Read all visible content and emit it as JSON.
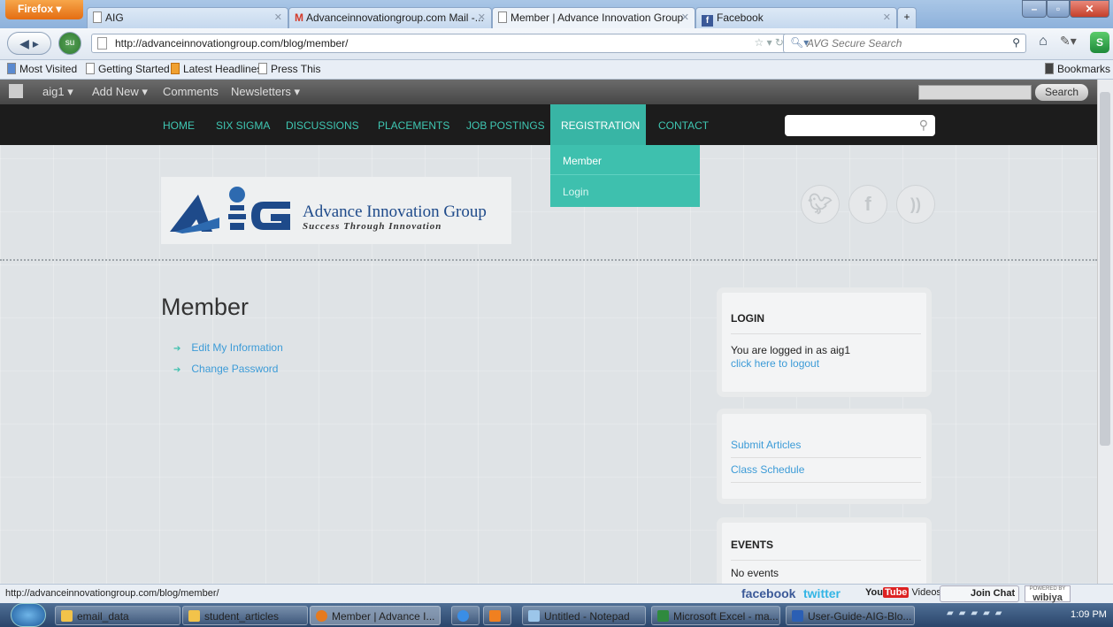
{
  "browser": {
    "menu_label": "Firefox",
    "tabs": [
      {
        "label": "AIG"
      },
      {
        "label": "Advanceinnovationgroup.com Mail -..."
      },
      {
        "label": "Member | Advance Innovation Group"
      },
      {
        "label": "Facebook"
      }
    ],
    "new_tab_label": "+",
    "url": "http://advanceinnovationgroup.com/blog/member/",
    "search_placeholder": "AVG Secure Search",
    "bookmarks": [
      "Most Visited",
      "Getting Started",
      "Latest Headlines",
      "Press This"
    ],
    "bookmarks_menu": "Bookmarks"
  },
  "admin_bar": {
    "user": "aig1",
    "items": [
      "Add New",
      "Comments",
      "Newsletters"
    ],
    "search_button": "Search"
  },
  "site": {
    "nav": [
      "HOME",
      "SIX SIGMA",
      "DISCUSSIONS",
      "PLACEMENTS",
      "JOB POSTINGS",
      "REGISTRATION",
      "CONTACT"
    ],
    "dropdown": [
      "Member",
      "Login"
    ],
    "logo_name": "Advance Innovation Group",
    "logo_tagline": "Success Through Innovation",
    "page_title": "Member",
    "links": [
      "Edit My Information",
      "Change Password"
    ],
    "login_widget": {
      "title": "LOGIN",
      "text": "You are logged in as aig1",
      "logout": "click here to logout"
    },
    "links_widget": [
      "Submit Articles",
      "Class Schedule"
    ],
    "events_widget": {
      "title": "EVENTS",
      "text": "No events"
    }
  },
  "status_bar": {
    "url": "http://advanceinnovationgroup.com/blog/member/",
    "facebook": "facebook",
    "twitter": "twitter",
    "youtube": "You",
    "youtube_tube": "Tube",
    "videos": "Videos",
    "join_chat": "Join Chat",
    "powered_by": "POWERED BY",
    "wibiya": "wibiya"
  },
  "taskbar": {
    "items": [
      "email_data",
      "student_articles",
      "Member | Advance I...",
      "Untitled - Notepad",
      "Microsoft Excel - ma...",
      "User-Guide-AIG-Blo..."
    ],
    "clock": "1:09 PM"
  }
}
